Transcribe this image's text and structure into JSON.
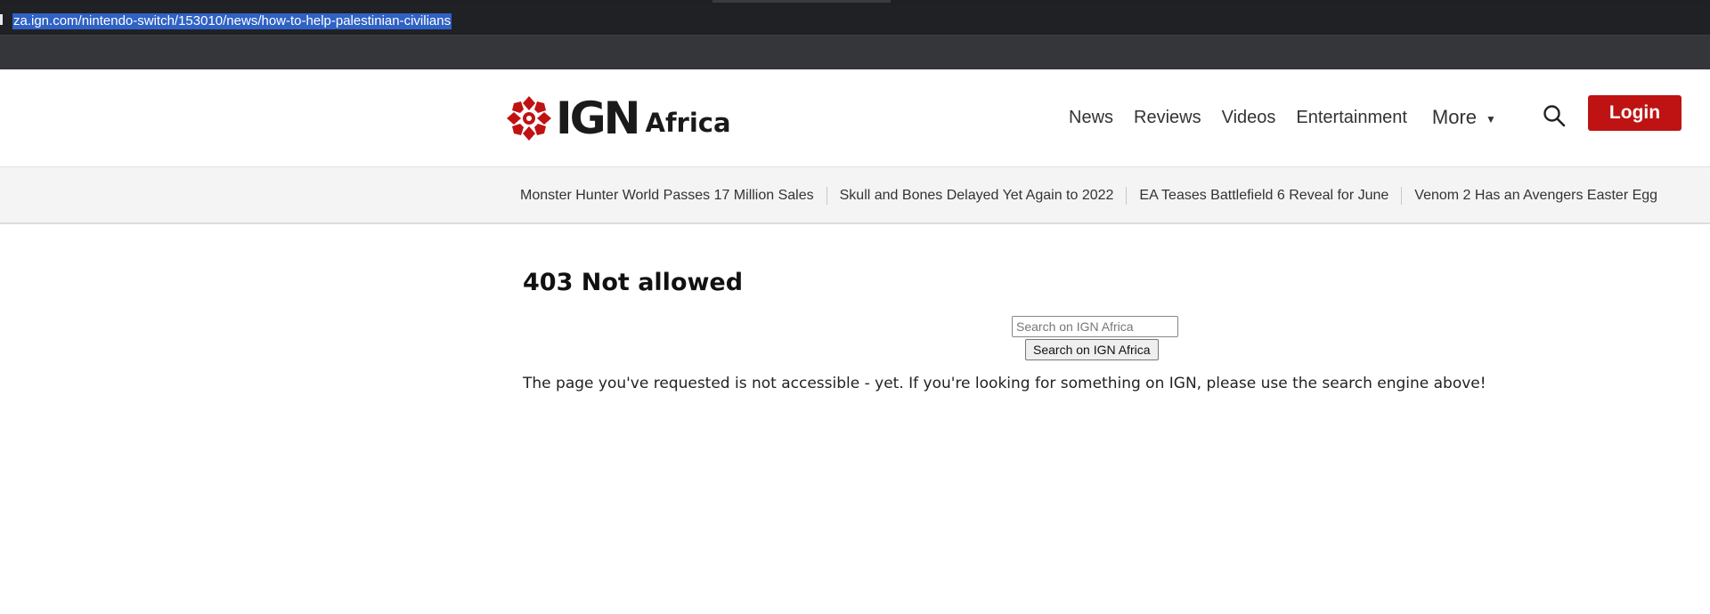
{
  "browser": {
    "url": "za.ign.com/nintendo-switch/153010/news/how-to-help-palestinian-civilians"
  },
  "header": {
    "logo_main": "IGN",
    "logo_region": "Africa",
    "nav": [
      "News",
      "Reviews",
      "Videos",
      "Entertainment"
    ],
    "more_label": "More",
    "login_label": "Login",
    "brand_color": "#bf1313"
  },
  "trending": [
    "Monster Hunter World Passes 17 Million Sales",
    "Skull and Bones Delayed Yet Again to 2022",
    "EA Teases Battlefield 6 Reveal for June",
    "Venom 2 Has an Avengers Easter Egg"
  ],
  "error": {
    "title": "403 Not allowed",
    "search_placeholder": "Search on IGN Africa",
    "search_button": "Search on IGN Africa",
    "message": "The page you've requested is not accessible - yet. If you're looking for something on IGN, please use the search engine above!"
  },
  "icons": {
    "logo": "ign-logo-icon",
    "search": "search-icon",
    "more": "chevron-down-icon"
  }
}
